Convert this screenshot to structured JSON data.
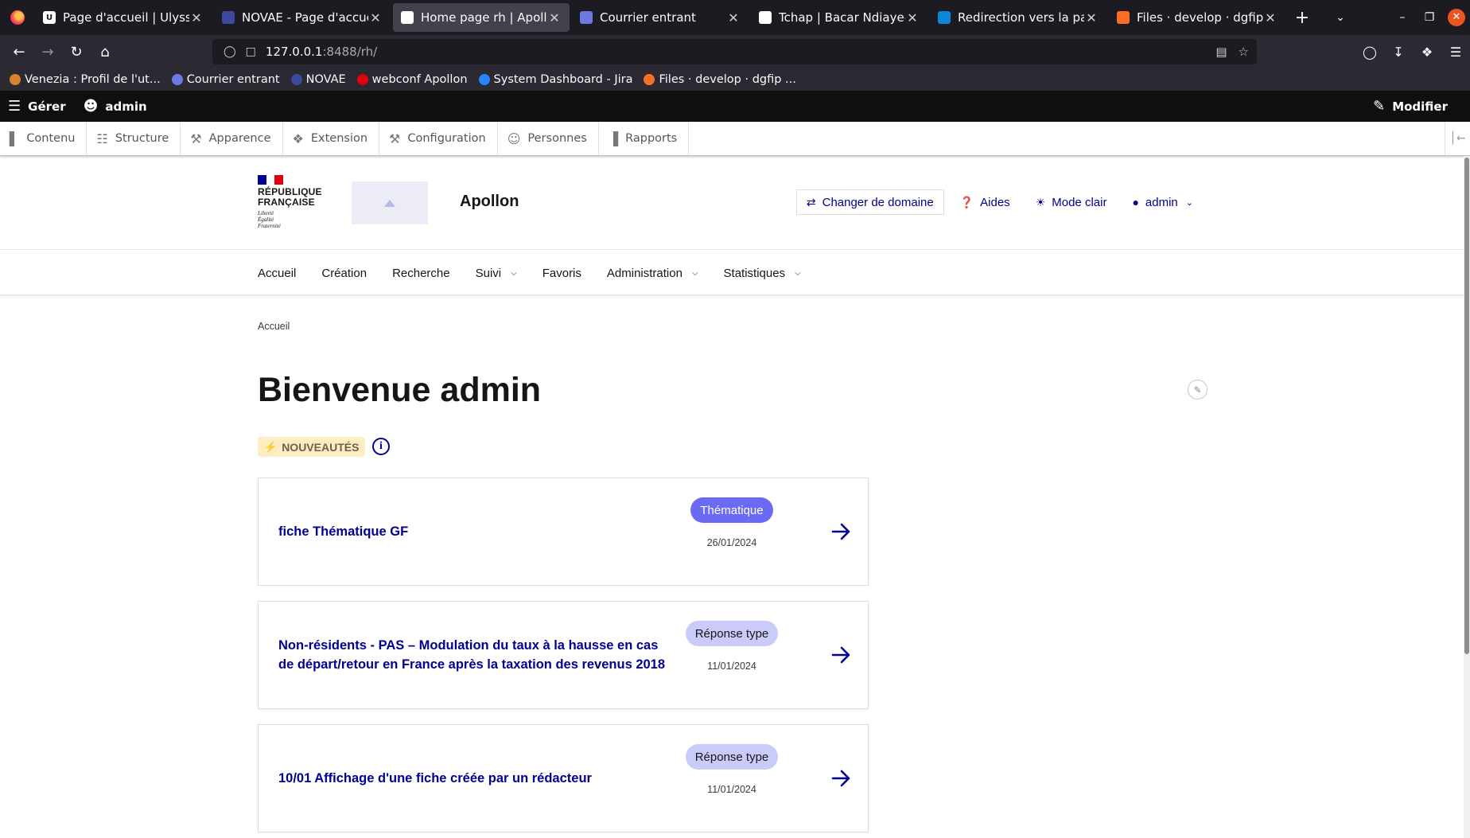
{
  "browser": {
    "tabs": [
      {
        "title": "Page d'accueil | Ulysse Na",
        "fav": "U",
        "favBg": "#ffffff",
        "favFg": "#1c1b22",
        "active": false
      },
      {
        "title": "NOVAE - Page d'accueil",
        "fav": "",
        "favBg": "#3b4a9c",
        "favFg": "#ffffff",
        "active": false
      },
      {
        "title": "Home page rh | Apollon",
        "fav": "",
        "favBg": "#ffffff",
        "favFg": "#e1000f",
        "active": true
      },
      {
        "title": "Courrier entrant",
        "fav": "",
        "favBg": "#6a7ae0",
        "favFg": "#ffffff",
        "active": false
      },
      {
        "title": "Tchap | Bacar Ndiaye-Con",
        "fav": "",
        "favBg": "#ffffff",
        "favFg": "#000091",
        "active": false
      },
      {
        "title": "Redirection vers la page c",
        "fav": "",
        "favBg": "#0b87d8",
        "favFg": "#ffffff",
        "active": false
      },
      {
        "title": "Files · develop · dgfip / BS",
        "fav": "",
        "favBg": "#fc6d26",
        "favFg": "#ffffff",
        "active": false
      }
    ],
    "url_host": "127.0.0.1",
    "url_path": ":8488/rh/",
    "bookmarks": [
      {
        "label": "Venezia : Profil de l'ut...",
        "color": "#d9822b"
      },
      {
        "label": "Courrier entrant",
        "color": "#6a7ae0"
      },
      {
        "label": "NOVAE",
        "color": "#3b4a9c"
      },
      {
        "label": "webconf Apollon",
        "color": "#e1000f"
      },
      {
        "label": "System Dashboard - Jira",
        "color": "#2684ff"
      },
      {
        "label": "Files · develop · dgfip ...",
        "color": "#fc6d26"
      }
    ]
  },
  "toolbar": {
    "manage_label": "Gérer",
    "user_label": "admin",
    "edit_label": "Modifier"
  },
  "tray": [
    {
      "label": "Contenu",
      "icon": "file-icon",
      "glyph": "▌"
    },
    {
      "label": "Structure",
      "icon": "sitemap-icon",
      "glyph": "☷"
    },
    {
      "label": "Apparence",
      "icon": "brush-icon",
      "glyph": "⚒"
    },
    {
      "label": "Extension",
      "icon": "puzzle-icon",
      "glyph": "❖"
    },
    {
      "label": "Configuration",
      "icon": "wrench-icon",
      "glyph": "⚒"
    },
    {
      "label": "Personnes",
      "icon": "people-icon",
      "glyph": "☺"
    },
    {
      "label": "Rapports",
      "icon": "bar-chart-icon",
      "glyph": "▐"
    }
  ],
  "header": {
    "rf_line1": "République",
    "rf_line2": "Française",
    "devise1": "Liberté",
    "devise2": "Égalité",
    "devise3": "Fraternité",
    "site_name": "Apollon",
    "change_domain": "Changer de domaine",
    "help": "Aides",
    "theme": "Mode clair",
    "account": "admin"
  },
  "nav": [
    {
      "label": "Accueil",
      "dropdown": false
    },
    {
      "label": "Création",
      "dropdown": false
    },
    {
      "label": "Recherche",
      "dropdown": false
    },
    {
      "label": "Suivi",
      "dropdown": true
    },
    {
      "label": "Favoris",
      "dropdown": false
    },
    {
      "label": "Administration",
      "dropdown": true
    },
    {
      "label": "Statistiques",
      "dropdown": true
    }
  ],
  "content": {
    "breadcrumb": "Accueil",
    "title": "Bienvenue admin",
    "news_badge": "Nouveautés"
  },
  "cards": [
    {
      "title": "fiche Thématique GF",
      "tag": "Thématique",
      "tagStyle": "primary",
      "date": "26/01/2024"
    },
    {
      "title": "Non-résidents - PAS – Modulation du taux à la hausse en cas de départ/retour en France après la taxation des revenus 2018",
      "tag": "Réponse type",
      "tagStyle": "secondary",
      "date": "11/01/2024"
    },
    {
      "title": "10/01 Affichage d'une fiche créée par un rédacteur",
      "tag": "Réponse type",
      "tagStyle": "secondary",
      "date": "11/01/2024"
    }
  ],
  "colors": {
    "dsfr_blue": "#000091",
    "tag_primary": "#6a6af4",
    "tag_secondary": "#cacafb",
    "news_bg": "#feecc2"
  }
}
